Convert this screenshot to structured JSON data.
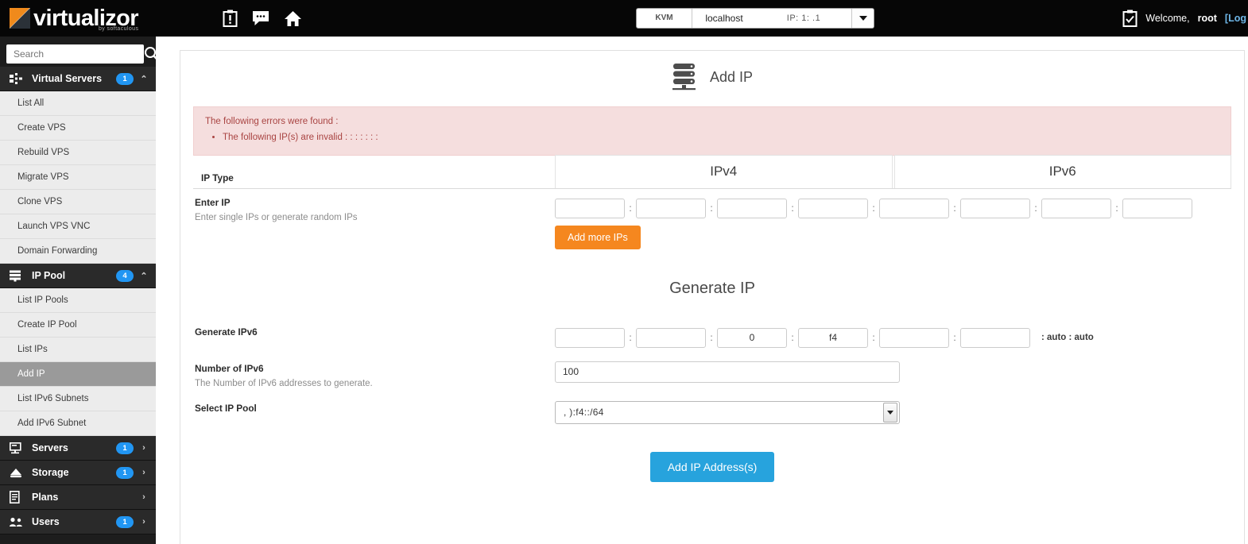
{
  "header": {
    "logo_text": "virtualizor",
    "logo_sub": "by softaculous",
    "icons": [
      {
        "name": "clipboard-alert-icon",
        "glyph": "clipboard"
      },
      {
        "name": "messages-icon",
        "glyph": "chat"
      },
      {
        "name": "home-icon",
        "glyph": "home"
      }
    ],
    "server_select": {
      "type": "KVM",
      "hostname": "localhost",
      "ip_label": "IP: 1:         .1"
    },
    "tasks_icon": "clipboard-check-icon",
    "welcome_text": "Welcome,",
    "user": "root",
    "logout": "[Log"
  },
  "sidebar": {
    "search_placeholder": "Search",
    "search_value": "",
    "groups": [
      {
        "name": "virtual-servers",
        "label": "Virtual Servers",
        "badge": "1",
        "chevron": "collapse",
        "icon": "servers-grid-icon",
        "items": [
          {
            "label": "List All",
            "active": false
          },
          {
            "label": "Create VPS",
            "active": false
          },
          {
            "label": "Rebuild VPS",
            "active": false
          },
          {
            "label": "Migrate VPS",
            "active": false
          },
          {
            "label": "Clone VPS",
            "active": false
          },
          {
            "label": "Launch VPS VNC",
            "active": false
          },
          {
            "label": "Domain Forwarding",
            "active": false
          }
        ]
      },
      {
        "name": "ip-pool",
        "label": "IP Pool",
        "badge": "4",
        "chevron": "collapse",
        "icon": "ip-pool-stack-icon",
        "items": [
          {
            "label": "List IP Pools",
            "active": false
          },
          {
            "label": "Create IP Pool",
            "active": false
          },
          {
            "label": "List IPs",
            "active": false
          },
          {
            "label": "Add IP",
            "active": true
          },
          {
            "label": "List IPv6 Subnets",
            "active": false
          },
          {
            "label": "Add IPv6 Subnet",
            "active": false
          }
        ]
      },
      {
        "name": "servers",
        "label": "Servers",
        "badge": "1",
        "chevron": "expand",
        "icon": "server-rack-icon",
        "items": []
      },
      {
        "name": "storage",
        "label": "Storage",
        "badge": "1",
        "chevron": "expand",
        "icon": "storage-disk-icon",
        "items": []
      },
      {
        "name": "plans",
        "label": "Plans",
        "badge": "",
        "chevron": "expand",
        "icon": "plans-clipboard-icon",
        "items": []
      },
      {
        "name": "users",
        "label": "Users",
        "badge": "1",
        "chevron": "expand",
        "icon": "users-icon",
        "items": []
      }
    ]
  },
  "page": {
    "title": "Add IP",
    "title_icon": "server-rack-icon",
    "error": {
      "heading": "The following errors were found :",
      "items": [
        "The following IP(s) are invalid : : : : : : :"
      ]
    },
    "ip_type": {
      "label": "IP Type",
      "tabs": [
        {
          "label": "IPv4",
          "active": false
        },
        {
          "label": "IPv6",
          "active": true
        }
      ]
    },
    "enter_ip": {
      "label": "Enter IP",
      "sub": "Enter single IPs or generate random IPs",
      "segments": [
        "",
        "",
        "",
        "",
        "",
        "",
        "",
        ""
      ],
      "separator": ":",
      "add_more_label": "Add more IPs"
    },
    "generate_heading": "Generate IP",
    "generate_ipv6": {
      "label": "Generate IPv6",
      "segments": [
        "",
        "",
        "0",
        "f4",
        "",
        ""
      ],
      "separator": ":",
      "tail": ": auto : auto"
    },
    "number_of_ipv6": {
      "label": "Number of IPv6",
      "sub": "The Number of IPv6 addresses to generate.",
      "value": "100"
    },
    "select_ip_pool": {
      "label": "Select IP Pool",
      "value": ",            ):f4::/64"
    },
    "submit_label": "Add IP Address(s)"
  },
  "colors": {
    "accent_orange": "#f5871f",
    "accent_blue": "#27a3dd",
    "badge_blue": "#2196f3",
    "error_bg": "#f5dede",
    "error_text": "#a94442",
    "topbar_bg": "#060606",
    "sidebar_bg": "#1d1d1d"
  }
}
